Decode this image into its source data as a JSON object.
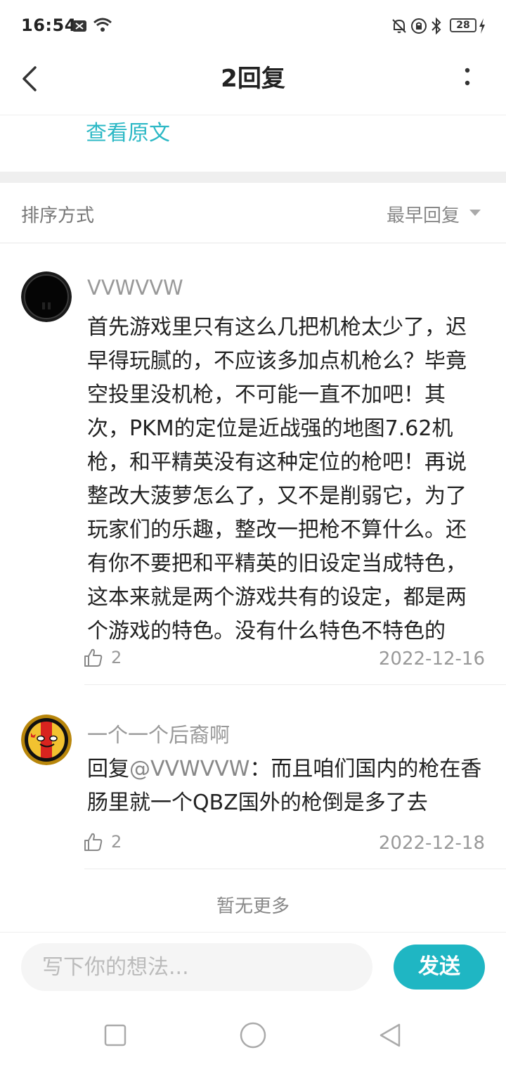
{
  "status_bar": {
    "time": "16:54",
    "battery": "28"
  },
  "header": {
    "title": "2回复"
  },
  "view_original": "查看原文",
  "sort": {
    "label": "排序方式",
    "value": "最早回复"
  },
  "comments": [
    {
      "username": "VVWVVW",
      "content": "首先游戏里只有这么几把机枪太少了，迟早得玩腻的，不应该多加点机枪么？毕竟空投里没机枪，不可能一直不加吧！其次，PKM的定位是近战强的地图7.62机枪，和平精英没有这种定位的枪吧！再说整改大菠萝怎么了，又不是削弱它，为了玩家们的乐趣，整改一把枪不算什么。还有你不要把和平精英的旧设定当成特色，这本来就是两个游戏共有的设定，都是两个游戏的特色。没有什么特色不特色的",
      "likes": "2",
      "date": "2022-12-16"
    },
    {
      "username": "一个一个后裔啊",
      "reply_prefix": "回复",
      "reply_to": "@VVWVVW",
      "content": "：而且咱们国内的枪在香肠里就一个QBZ国外的枪倒是多了去",
      "likes": "2",
      "date": "2022-12-18"
    }
  ],
  "no_more": "暂无更多",
  "input": {
    "placeholder": "写下你的想法..."
  },
  "send_label": "发送",
  "colors": {
    "accent": "#1fb6c3",
    "link": "#2bb8c5"
  }
}
